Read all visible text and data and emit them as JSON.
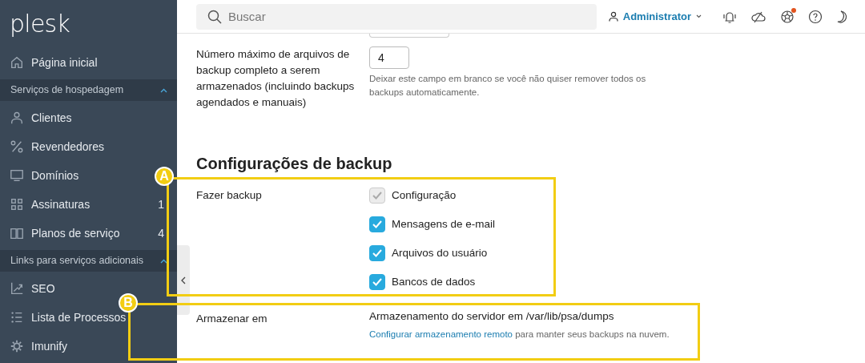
{
  "sidebar": {
    "logo": "plesk",
    "items": [
      {
        "kind": "item",
        "label": "Página inicial"
      },
      {
        "kind": "header",
        "label": "Serviços de hospedagem",
        "expanded": true
      },
      {
        "kind": "item",
        "label": "Clientes"
      },
      {
        "kind": "item",
        "label": "Revendedores"
      },
      {
        "kind": "item",
        "label": "Domínios"
      },
      {
        "kind": "item",
        "label": "Assinaturas",
        "count": "1"
      },
      {
        "kind": "item",
        "label": "Planos de serviço",
        "count": "4"
      },
      {
        "kind": "header",
        "label": "Links para serviços adicionais",
        "expanded": true
      },
      {
        "kind": "item",
        "label": "SEO"
      },
      {
        "kind": "item",
        "label": "Lista de Processos"
      },
      {
        "kind": "item",
        "label": "Imunify"
      }
    ]
  },
  "topbar": {
    "search": {
      "placeholder": "Buscar"
    },
    "user": "Administrator",
    "notification_dot": true
  },
  "form": {
    "max_backups": {
      "label": "Número máximo de arquivos de backup completo a serem armazenados (incluindo backups agendados e manuais)",
      "value": "4",
      "hint": "Deixar este campo em branco se você não quiser remover todos os backups automaticamente."
    },
    "heading": "Configurações de backup",
    "backup": {
      "label": "Fazer backup",
      "options": [
        {
          "label": "Configuração",
          "checked": true,
          "disabled": true
        },
        {
          "label": "Mensagens de e-mail",
          "checked": true,
          "disabled": false
        },
        {
          "label": "Arquivos do usuário",
          "checked": true,
          "disabled": false
        },
        {
          "label": "Bancos de dados",
          "checked": true,
          "disabled": false
        }
      ]
    },
    "storage": {
      "label": "Armazenar em",
      "value": "Armazenamento do servidor em /var/lib/psa/dumps",
      "note_link": "Configurar armazenamento remoto",
      "note_rest": " para manter seus backups na nuvem."
    }
  },
  "callouts": [
    "A",
    "B"
  ]
}
